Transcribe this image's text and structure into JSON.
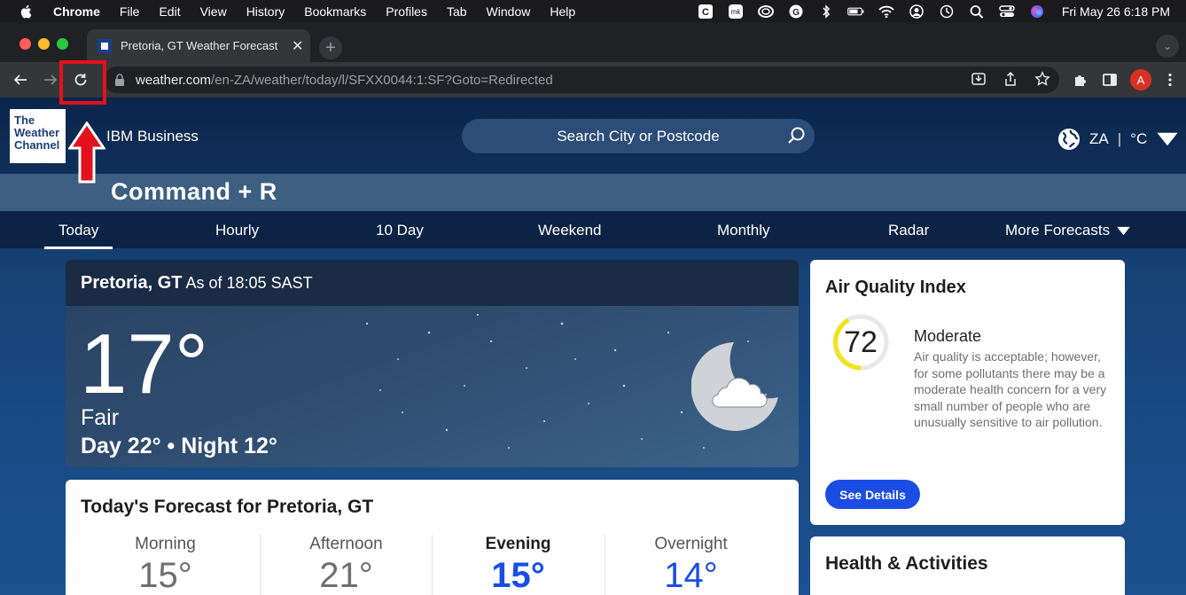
{
  "menubar": {
    "app": "Chrome",
    "items": [
      "File",
      "Edit",
      "View",
      "History",
      "Bookmarks",
      "Profiles",
      "Tab",
      "Window",
      "Help"
    ],
    "clock": "Fri May 26  6:18 PM"
  },
  "browser": {
    "tab_title": "Pretoria, GT Weather Forecast",
    "url_host": "weather.com",
    "url_path": "/en-ZA/weather/today/l/SFXX0044:1:SF?Goto=Redirected",
    "avatar_letter": "A"
  },
  "site": {
    "logo_lines": [
      "The",
      "Weather",
      "Channel"
    ],
    "business_label": "IBM Business",
    "search_placeholder": "Search City or Postcode",
    "locale_country": "ZA",
    "locale_sep": "|",
    "locale_unit": "°C"
  },
  "overlay": {
    "shortcut_caption": "Command + R",
    "highlight_color": "#e3111b"
  },
  "nav": {
    "items": [
      "Today",
      "Hourly",
      "10 Day",
      "Weekend",
      "Monthly",
      "Radar",
      "More Forecasts"
    ]
  },
  "current": {
    "location": "Pretoria, GT",
    "as_of": "As of 18:05 SAST",
    "temperature": "17°",
    "phrase": "Fair",
    "day_night": "Day 22° • Night 12°",
    "icon": "partly-cloudy-night-icon"
  },
  "aqi": {
    "title": "Air Quality Index",
    "value": "72",
    "category": "Moderate",
    "description": "Air quality is acceptable; however, for some pollutants there may be a moderate health concern for a very small number of people who are unusually sensitive to air pollution.",
    "button": "See Details",
    "gauge_color": "#f3e416"
  },
  "forecast": {
    "title": "Today's Forecast for Pretoria, GT",
    "periods": [
      {
        "label": "Morning",
        "temp": "15°"
      },
      {
        "label": "Afternoon",
        "temp": "21°"
      },
      {
        "label": "Evening",
        "temp": "15°"
      },
      {
        "label": "Overnight",
        "temp": "14°"
      }
    ]
  },
  "health": {
    "title": "Health & Activities"
  },
  "colors": {
    "accent_blue": "#1b4de4",
    "page_bg": "#174478"
  }
}
